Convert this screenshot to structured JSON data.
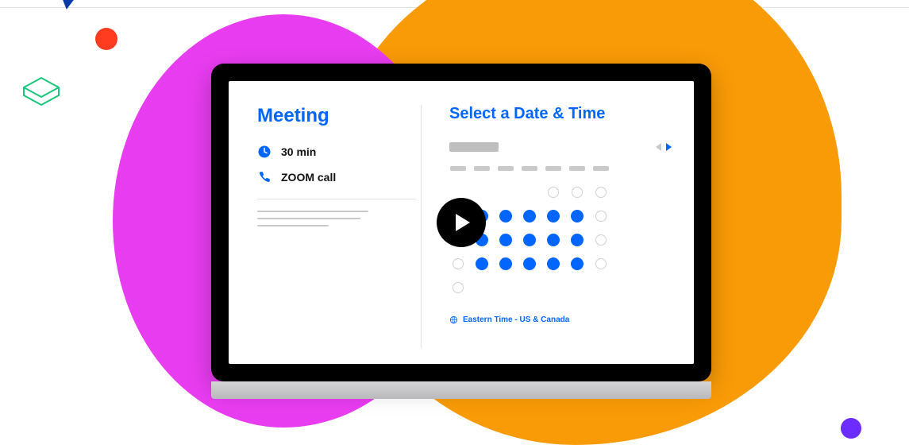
{
  "meeting": {
    "title": "Meeting",
    "duration": "30 min",
    "call_type": "ZOOM call"
  },
  "scheduler": {
    "heading": "Select a Date & Time",
    "timezone_label": "Eastern Time - US & Canada"
  },
  "calendar": {
    "headers": [
      "",
      "",
      "",
      "",
      "",
      "",
      ""
    ],
    "days": [
      [
        "none",
        "none",
        "none",
        "none",
        "empty",
        "empty",
        "empty"
      ],
      [
        "empty",
        "avail",
        "avail",
        "avail",
        "avail",
        "avail",
        "empty"
      ],
      [
        "empty",
        "avail",
        "avail",
        "avail",
        "avail",
        "avail",
        "empty"
      ],
      [
        "empty",
        "avail",
        "avail",
        "avail",
        "avail",
        "avail",
        "empty"
      ],
      [
        "empty",
        "none",
        "none",
        "none",
        "none",
        "none",
        "none"
      ]
    ]
  },
  "colors": {
    "accent": "#0066ff",
    "pink": "#e83cf0",
    "orange": "#f99b07"
  }
}
